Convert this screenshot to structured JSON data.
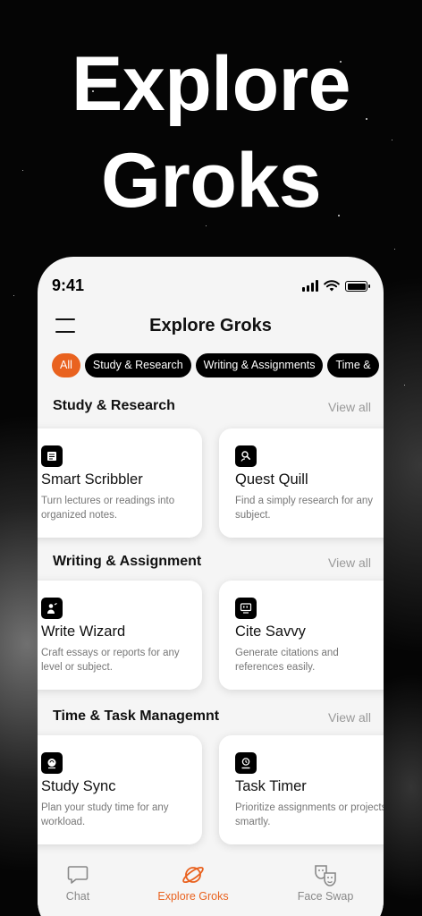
{
  "hero": {
    "line1": "Explore",
    "line2": "Groks"
  },
  "status": {
    "time": "9:41"
  },
  "header": {
    "title": "Explore Groks"
  },
  "chips": [
    "All",
    "Study & Research",
    "Writing & Assignments",
    "Time &"
  ],
  "sections": [
    {
      "title": "Study & Research",
      "view_all": "View all",
      "cards": [
        {
          "title": "Smart Scribbler",
          "desc": "Turn lectures or readings into organized notes.",
          "icon": "notes-icon"
        },
        {
          "title": "Quest Quill",
          "desc": "Find a simply research for any subject.",
          "icon": "research-search-icon"
        }
      ]
    },
    {
      "title": "Writing & Assignment",
      "view_all": "View all",
      "cards": [
        {
          "title": "Write Wizard",
          "desc": "Craft essays or reports for any level or subject.",
          "icon": "wizard-writer-icon"
        },
        {
          "title": "Cite Savvy",
          "desc": "Generate citations and references easily.",
          "icon": "citation-icon"
        }
      ]
    },
    {
      "title": "Time & Task Managemnt",
      "view_all": "View all",
      "cards": [
        {
          "title": "Study Sync",
          "desc": "Plan your study time for any workload.",
          "icon": "brain-sync-icon"
        },
        {
          "title": "Task Timer",
          "desc": "Prioritize assignments or projects smartly.",
          "icon": "task-timer-icon"
        }
      ]
    }
  ],
  "bottom_nav": [
    {
      "label": "Chat",
      "icon": "chat-bubble-icon",
      "active": false
    },
    {
      "label": "Explore Groks",
      "icon": "planet-icon",
      "active": true
    },
    {
      "label": "Face Swap",
      "icon": "masks-icon",
      "active": false
    }
  ],
  "colors": {
    "accent": "#e9621f",
    "chip": "#000000",
    "background": "#f5f5f5"
  }
}
